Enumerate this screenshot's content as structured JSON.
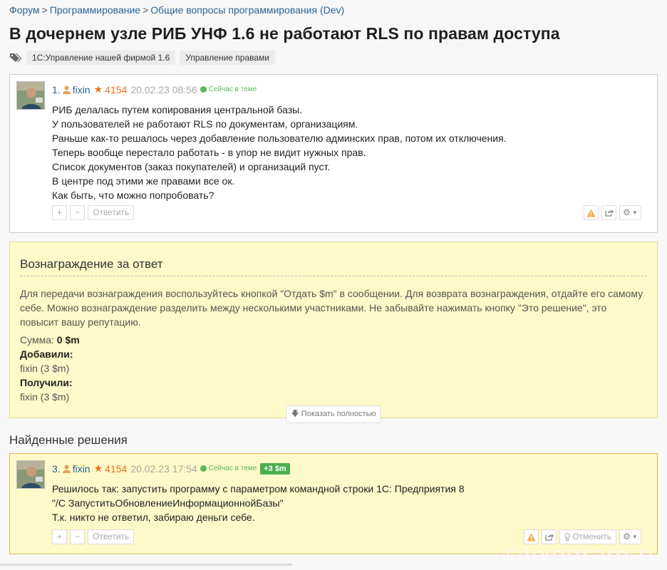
{
  "breadcrumb": {
    "items": [
      "Форум",
      "Программирование",
      "Общие вопросы программирования (Dev)"
    ],
    "separator": ">"
  },
  "title": "В дочернем узле РИБ УНФ 1.6 не работают RLS по правам доступа",
  "tags": [
    "1С:Управление нашей фирмой 1.6",
    "Управление правами"
  ],
  "post1": {
    "number": "1.",
    "author": "fixin",
    "rating": "4154",
    "date": "20.02.23 08:56",
    "status": "Сейчас в теме",
    "lines": [
      "РИБ делалась путем копирования центральной базы.",
      "У пользователей не работают RLS по документам, организациям.",
      "Раньше как-то решалось через добавление пользователю админских прав, потом их отключения.",
      "Теперь вообще перестало работать - в упор не видит нужных прав.",
      "Список документов (заказ покупателей) и организаций пуст.",
      "В центре под этими же правами все ок.",
      "Как быть, что можно попробовать?"
    ],
    "plus_label": "+",
    "minus_label": "−",
    "reply_label": "Ответить"
  },
  "reward": {
    "heading": "Вознаграждение за ответ",
    "description": "Для передачи вознаграждения воспользуйтесь кнопкой \"Отдать $m\" в сообщении. Для возврата вознаграждения, отдайте его самому себе. Можно вознаграждение разделить между несколькими участниками. Не забывайте нажимать кнопку \"Это решение\", это повысит вашу репутацию.",
    "sum_label": "Сумма:",
    "sum_value": "0 $m",
    "added_label": "Добавили:",
    "added_value": "fixin (3 $m)",
    "received_label": "Получили:",
    "received_value": "fixin (3 $m)",
    "show_full": "Показать полностью"
  },
  "found_heading": "Найденные решения",
  "post3": {
    "number": "3.",
    "author": "fixin",
    "rating": "4154",
    "date": "20.02.23 17:54",
    "status": "Сейчас в теме",
    "badge": "+3 $m",
    "lines": [
      "Решилось так: запустить программу с параметром командной строки 1С: Предприятия 8",
      "\"/С ЗапуститьОбновлениеИнформационнойБазы\"",
      "Т.к. никто не ответил, забираю деньги себе."
    ],
    "plus_label": "+",
    "minus_label": "−",
    "reply_label": "Ответить",
    "cancel_label": "Отменить"
  },
  "watermark": "©lixogram.ru",
  "colors": {
    "link": "#2a6496",
    "rating": "#e8731d",
    "online": "#5cb85c",
    "reward_bg": "#fdf9c8"
  }
}
